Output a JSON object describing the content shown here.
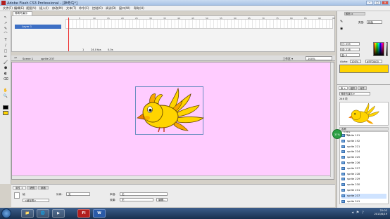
{
  "window": {
    "title": "Adobe Flash CS3 Professional - [神奇鸟*]",
    "min_label": "–",
    "max_label": "□",
    "close_label": "×"
  },
  "menu": [
    "文件(F)",
    "编辑(E)",
    "视图(V)",
    "插入(I)",
    "修改(M)",
    "文本(T)",
    "命令(C)",
    "控制(O)",
    "调试(D)",
    "窗口(W)",
    "帮助(H)"
  ],
  "document_tab": "神奇鸟演示",
  "tools": [
    "↖",
    "↗",
    "✎",
    "⌒",
    "T",
    "/",
    "□",
    "✏",
    "🖌",
    "⬢",
    "◐",
    "⌫",
    "✋",
    "🔍"
  ],
  "timeline": {
    "layer_name": "Layer 1",
    "frame_numbers": [
      "5",
      "10",
      "15",
      "20",
      "25",
      "30",
      "35",
      "40",
      "45",
      "50",
      "55",
      "60",
      "65",
      "70",
      "75",
      "80",
      "85",
      "90",
      "95"
    ],
    "current_frame": "1",
    "fps": "24.0 fps",
    "time": "0.0s"
  },
  "editbar": {
    "scene": "Scene 1",
    "symbol": "sprite 237",
    "workspace": "工作区 ▾",
    "zoom": "100%"
  },
  "properties": {
    "tabs": [
      "属性 ×",
      "滤镜",
      "参数"
    ],
    "label_frame": "帧",
    "frame_placeholder": "<帧标签>",
    "tween_label": "补间:",
    "tween_value": "无",
    "sound_label": "声音:",
    "sound_value": "无",
    "effect_label": "效果:",
    "effect_value": "无",
    "edit_label": "编辑..."
  },
  "color_panel": {
    "tab": "颜色 ×",
    "type_label": "类型:",
    "type_value": "纯色",
    "r": "红: 255",
    "g": "绿: 218",
    "b": "蓝: 0",
    "alpha_label": "Alpha:",
    "alpha_value": "100%",
    "hex": "#FFDA00",
    "fill_color": "#ffda00"
  },
  "library": {
    "tabs": [
      "库 ×",
      "组件",
      "对齐"
    ],
    "document": "神奇鸟演示 ▾",
    "count": "246 项",
    "header": "名称",
    "items": [
      "sprite 191",
      "sprite 192",
      "sprite 221",
      "sprite 224",
      "sprite 225",
      "sprite 226",
      "sprite 227",
      "sprite 228",
      "sprite 229",
      "sprite 230",
      "sprite 231",
      "sprite 237",
      "sprite 241"
    ],
    "selected_item": "sprite 237",
    "bubble": "37%",
    "speed_up": "0.8K/s",
    "speed_down": "4.8K/s"
  },
  "taskbar": {
    "apps": [
      "📁",
      "🌐",
      "▶",
      "Fl",
      "W"
    ],
    "time": "22:02",
    "date": "2013/6/19"
  },
  "colors": {
    "stage_bg": "#ffccff",
    "bird_yellow": "#ffd400",
    "bird_orange": "#f7a600",
    "layer_selected": "#3d6fc4"
  }
}
